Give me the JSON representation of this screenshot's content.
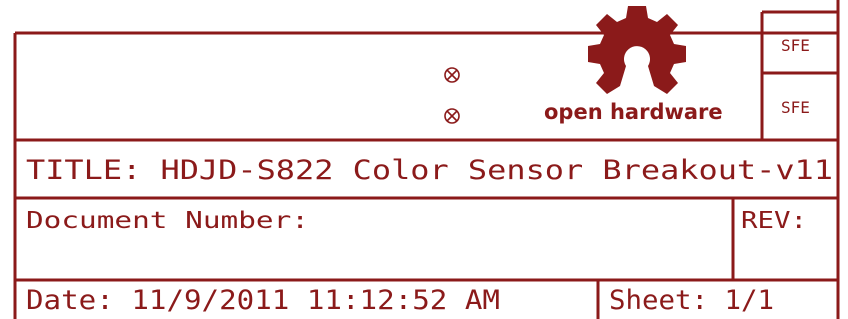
{
  "title_block": {
    "title": "TITLE: HDJD-S822 Color Sensor Breakout-v11",
    "document_number_label": "Document Number:",
    "rev_label": "REV:",
    "date": "Date: 11/9/2011 11:12:52 AM",
    "sheet": "Sheet: 1/1",
    "sfe_top": "SFE",
    "sfe_bottom": "SFE"
  },
  "logo": {
    "text": "open hardware",
    "icon": "open-hardware-gear-icon"
  },
  "markers": {
    "icon": "circle-cross-icon",
    "count": 2
  },
  "colors": {
    "ink": "#8b1a1a",
    "background": "#ffffff"
  }
}
